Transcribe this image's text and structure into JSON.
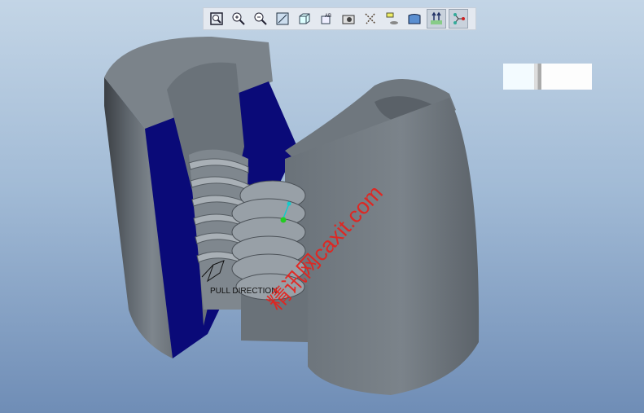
{
  "toolbar": {
    "buttons": [
      {
        "name": "refit",
        "icon": "zoom-fit-icon",
        "active": false
      },
      {
        "name": "zoom-in",
        "icon": "zoom-in-icon",
        "active": false
      },
      {
        "name": "zoom-out",
        "icon": "zoom-out-icon",
        "active": false
      },
      {
        "name": "repaint",
        "icon": "repaint-icon",
        "active": false
      },
      {
        "name": "display-style",
        "icon": "shaded-cube-icon",
        "active": false
      },
      {
        "name": "saved-views",
        "icon": "saved-views-icon",
        "active": false
      },
      {
        "name": "view-manager",
        "icon": "camera-icon",
        "active": false
      },
      {
        "name": "datum-display",
        "icon": "datum-axes-icon",
        "active": false
      },
      {
        "name": "annotation-display",
        "icon": "annotation-icon",
        "active": false
      },
      {
        "name": "surface-display",
        "icon": "surface-icon",
        "active": false
      },
      {
        "name": "pull-direction",
        "icon": "pull-direction-icon",
        "active": true
      },
      {
        "name": "spin-center",
        "icon": "spin-center-icon",
        "active": true
      }
    ]
  },
  "viewport": {
    "pull_direction_label": "PULL DIRECTION",
    "watermark": "精讯网caxit.com"
  },
  "colors": {
    "cut_face": "#0a0a78",
    "body": "#6e767e",
    "watermark": "#e8201a"
  }
}
